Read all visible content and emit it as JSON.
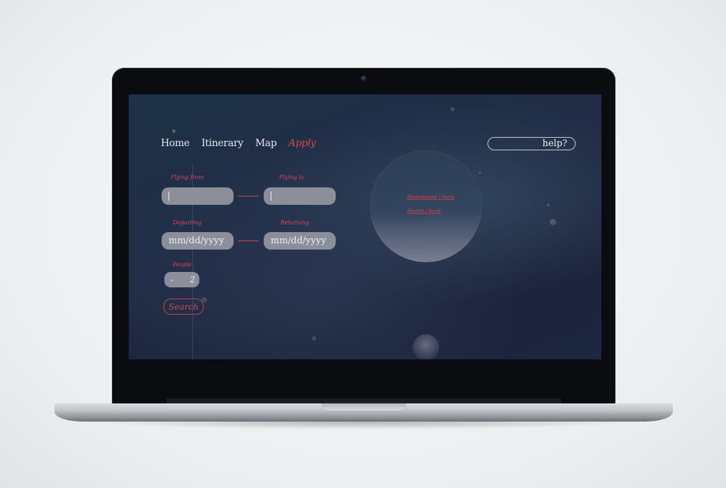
{
  "nav": {
    "items": [
      {
        "label": "Home",
        "active": false
      },
      {
        "label": "Itinerary",
        "active": false
      },
      {
        "label": "Map",
        "active": false
      },
      {
        "label": "Apply",
        "active": true
      }
    ]
  },
  "help": {
    "label": "help?"
  },
  "form": {
    "flying_from": {
      "label": "Flying from",
      "value": ""
    },
    "flying_to": {
      "label": "Flying to",
      "value": ""
    },
    "departing": {
      "label": "Departing",
      "value": "mm/dd/yyyy"
    },
    "returning": {
      "label": "Returning",
      "value": "mm/dd/yyyy"
    },
    "people": {
      "label": "People",
      "value": "2"
    },
    "search_label": "Search"
  },
  "circle_links": {
    "background_check": "Background Check",
    "health_check": "Health Check"
  },
  "colors": {
    "accent": "#d8454c",
    "field_bg": "#8c8e9a",
    "screen_bg": "#1e2a42"
  }
}
